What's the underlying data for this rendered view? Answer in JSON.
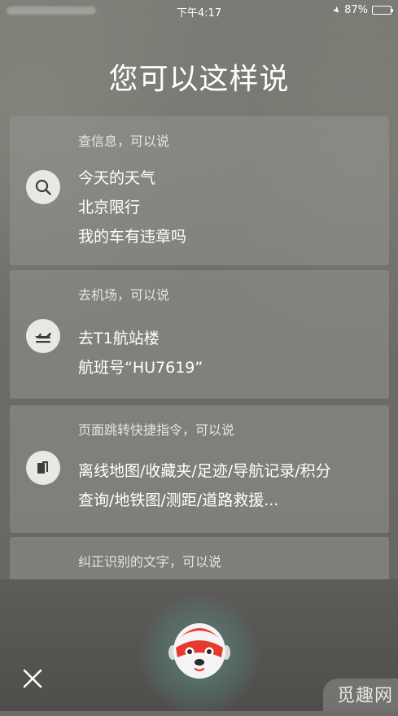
{
  "status_bar": {
    "time": "下午4:17",
    "battery_text": "87%",
    "battery_level": 0.87
  },
  "title": "您可以这样说",
  "cards": [
    {
      "header": "查信息，可以说",
      "icon": "search-icon",
      "lines": [
        "今天的天气",
        "北京限行",
        "我的车有违章吗"
      ]
    },
    {
      "header": "去机场，可以说",
      "icon": "airplane-icon",
      "lines": [
        "去T1航站楼",
        "航班号“HU7619”"
      ]
    },
    {
      "header": "页面跳转快捷指令，可以说",
      "icon": "pages-icon",
      "lines": [
        "离线地图/收藏夹/足迹/导航记录/积分",
        "查询/地铁图/测距/道路救援..."
      ]
    },
    {
      "header": "纠正识别的文字，可以说"
    }
  ],
  "bottom": {
    "close_icon": "close-icon",
    "mascot_icon": "voice-assistant-mascot-icon"
  },
  "watermark": {
    "text": "觅趣网"
  },
  "colors": {
    "card_background": "#969691",
    "icon_circle": "#e8e8e4",
    "mascot_red": "#e8392e",
    "glow": "#78d2c8"
  }
}
